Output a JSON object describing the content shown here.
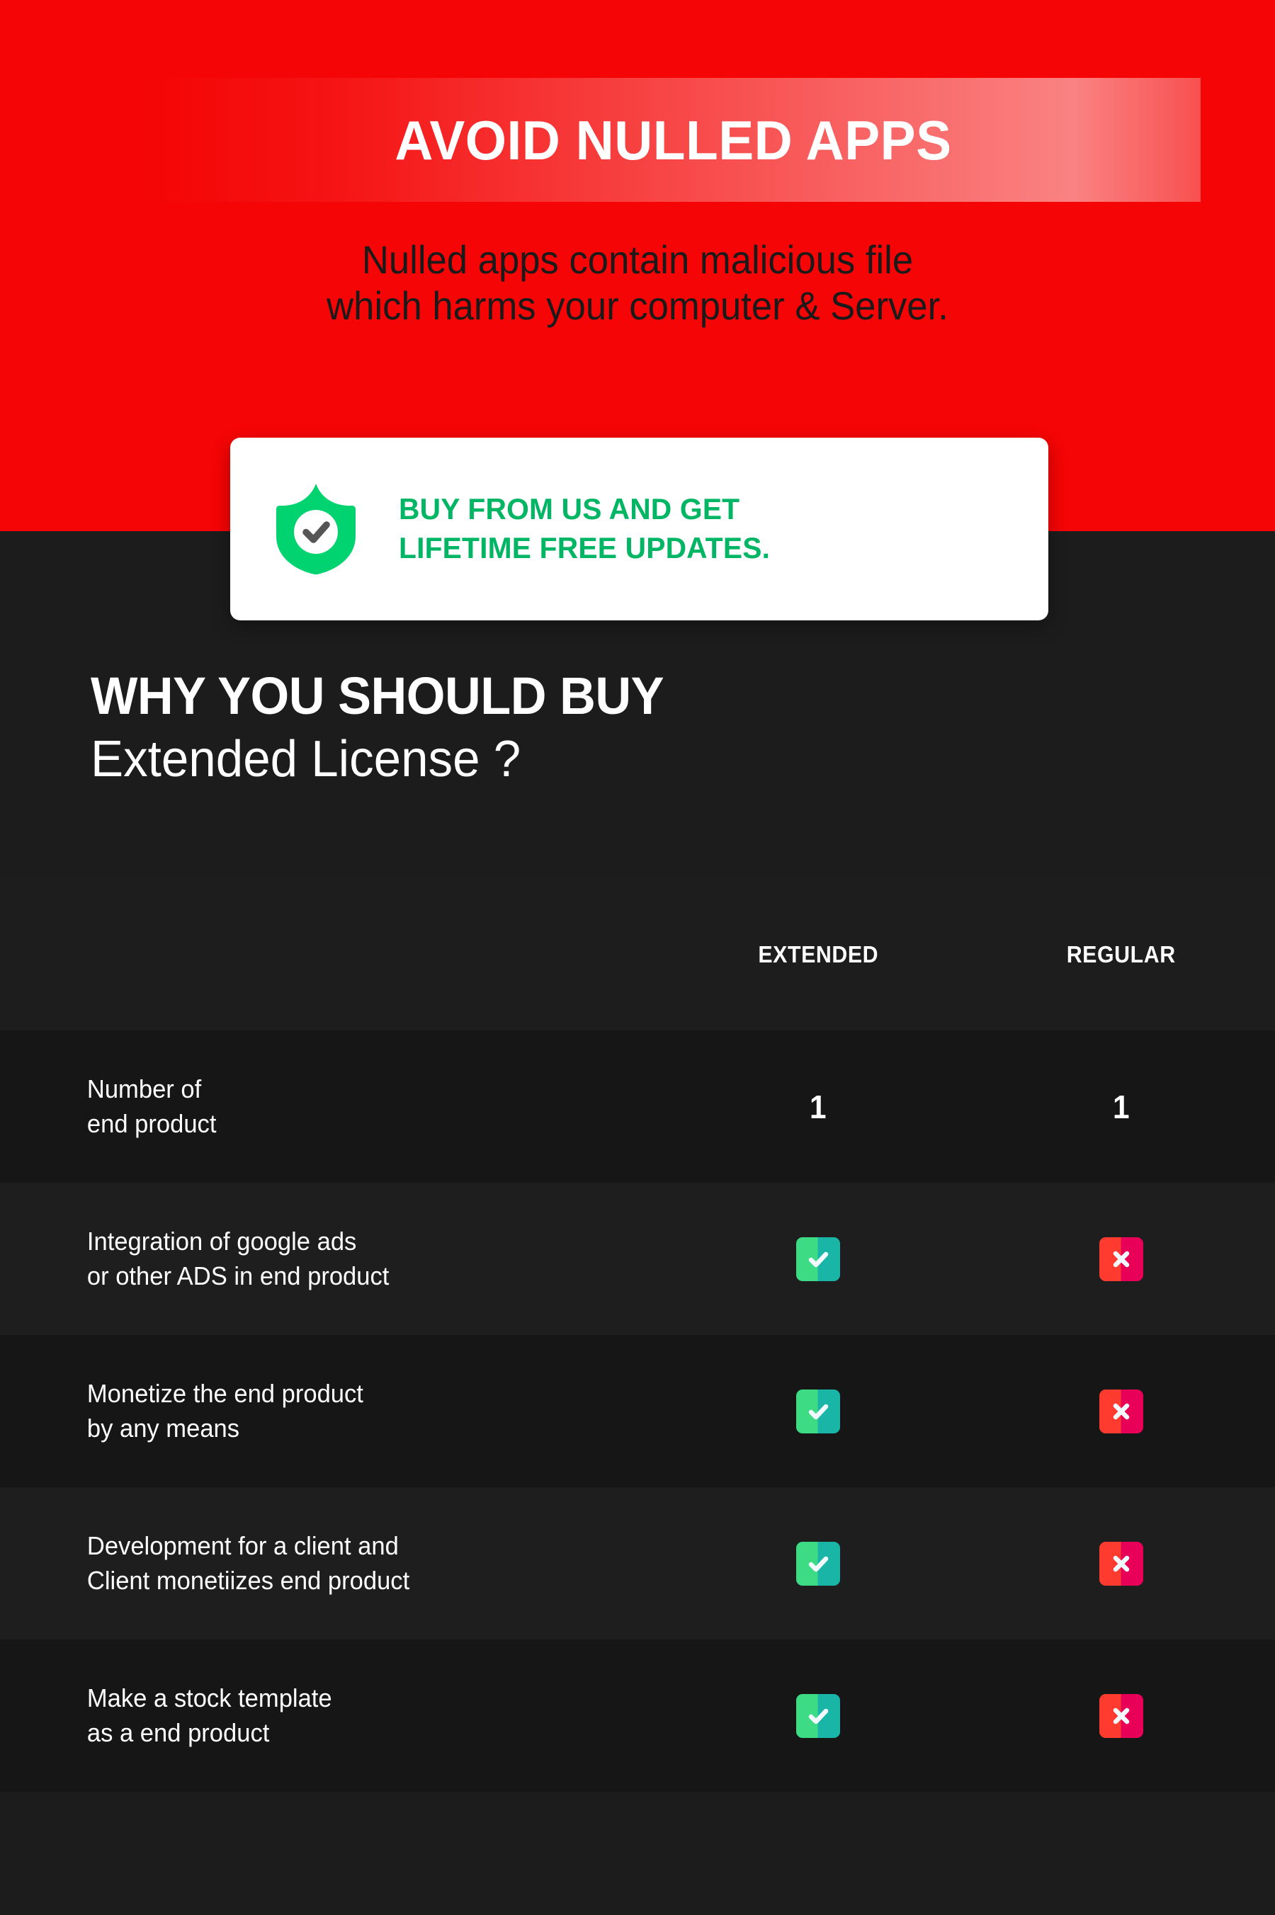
{
  "hero": {
    "title": "AVOID NULLED APPS",
    "subtitle_line1": "Nulled apps contain malicious file",
    "subtitle_line2": "which harms your computer & Server.",
    "bg_color": "#F50505",
    "title_color": "#FFFFFF",
    "subtitle_color": "#1A1A1A"
  },
  "badge": {
    "icon": "shield-check-icon",
    "line1": "BUY FROM US AND GET",
    "line2": "LIFETIME FREE UPDATES.",
    "text_color": "#00B563",
    "card_color": "#FFFFFF",
    "shield_color": "#00D36F"
  },
  "section": {
    "heading_bold": "WHY YOU SHOULD BUY",
    "heading_light": "Extended License ?",
    "bg_color": "#1C1C1C",
    "text_color": "#FFFFFF"
  },
  "comparison": {
    "columns": {
      "feature": "",
      "extended": "EXTENDED",
      "regular": "REGULAR"
    },
    "highlight_color": "#2E2E2E",
    "highlight_border": "#E9EDF2",
    "check_colors": [
      "#3DDC84",
      "#19B6A8"
    ],
    "cross_colors": [
      "#FF3B30",
      "#E80058"
    ],
    "rows": [
      {
        "label_line1": "Number of",
        "label_line2": "end product",
        "extended": "1",
        "regular": "1",
        "type": "text"
      },
      {
        "label_line1": "Integration of google ads",
        "label_line2": "or other ADS in end product",
        "extended": "check",
        "regular": "cross",
        "type": "icon"
      },
      {
        "label_line1": "Monetize the end product",
        "label_line2": "by any means",
        "extended": "check",
        "regular": "cross",
        "type": "icon"
      },
      {
        "label_line1": "Development for a client and",
        "label_line2": "Client monetiizes end product",
        "extended": "check",
        "regular": "cross",
        "type": "icon"
      },
      {
        "label_line1": "Make a stock template",
        "label_line2": "as a end product",
        "extended": "check",
        "regular": "cross",
        "type": "icon"
      }
    ]
  }
}
